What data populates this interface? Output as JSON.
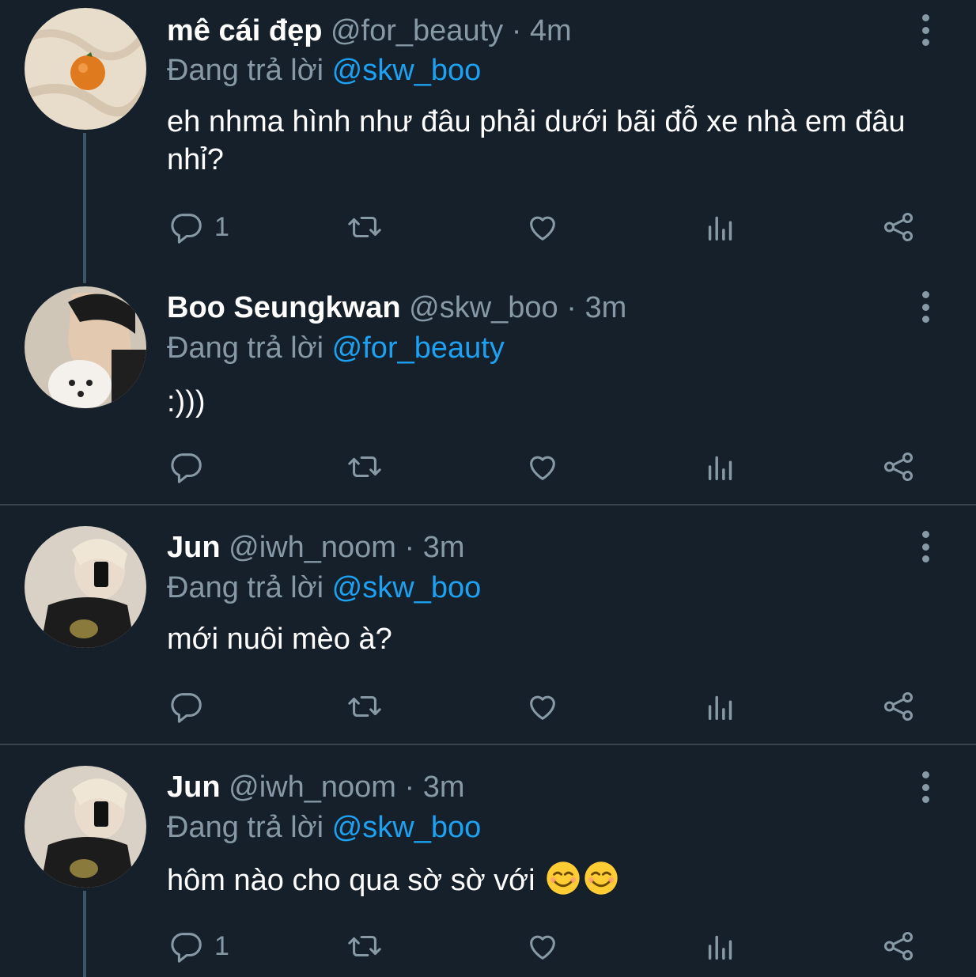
{
  "colors": {
    "background": "#15202b",
    "muted": "#8899a6",
    "accent": "#1da1f2",
    "divider": "#38444d"
  },
  "tweets": [
    {
      "name": "mê cái đẹp",
      "handle": "@for_beauty",
      "separator": "·",
      "time": "4m",
      "reply_prefix": "Đang trả lời",
      "reply_to": "@skw_boo",
      "text": "eh nhma hình như đâu phải dưới bãi đỗ xe nhà em đâu nhỉ?",
      "reply_count": "1",
      "avatar_icon": "orange-on-sheet-avatar"
    },
    {
      "name": "Boo Seungkwan",
      "handle": "@skw_boo",
      "separator": "·",
      "time": "3m",
      "reply_prefix": "Đang trả lời",
      "reply_to": "@for_beauty",
      "text": ":)))",
      "reply_count": "",
      "avatar_icon": "person-with-dog-avatar"
    },
    {
      "name": "Jun",
      "handle": "@iwh_noom",
      "separator": "·",
      "time": "3m",
      "reply_prefix": "Đang trả lời",
      "reply_to": "@skw_boo",
      "text": "mới nuôi mèo à?",
      "reply_count": "",
      "avatar_icon": "mirror-selfie-avatar"
    },
    {
      "name": "Jun",
      "handle": "@iwh_noom",
      "separator": "·",
      "time": "3m",
      "reply_prefix": "Đang trả lời",
      "reply_to": "@skw_boo",
      "text": "hôm nào cho qua sờ sờ với",
      "reply_count": "1",
      "emoji": "☺☺",
      "avatar_icon": "mirror-selfie-avatar"
    }
  ],
  "action_icons": [
    "reply-icon",
    "retweet-icon",
    "like-icon",
    "analytics-icon",
    "share-icon"
  ]
}
